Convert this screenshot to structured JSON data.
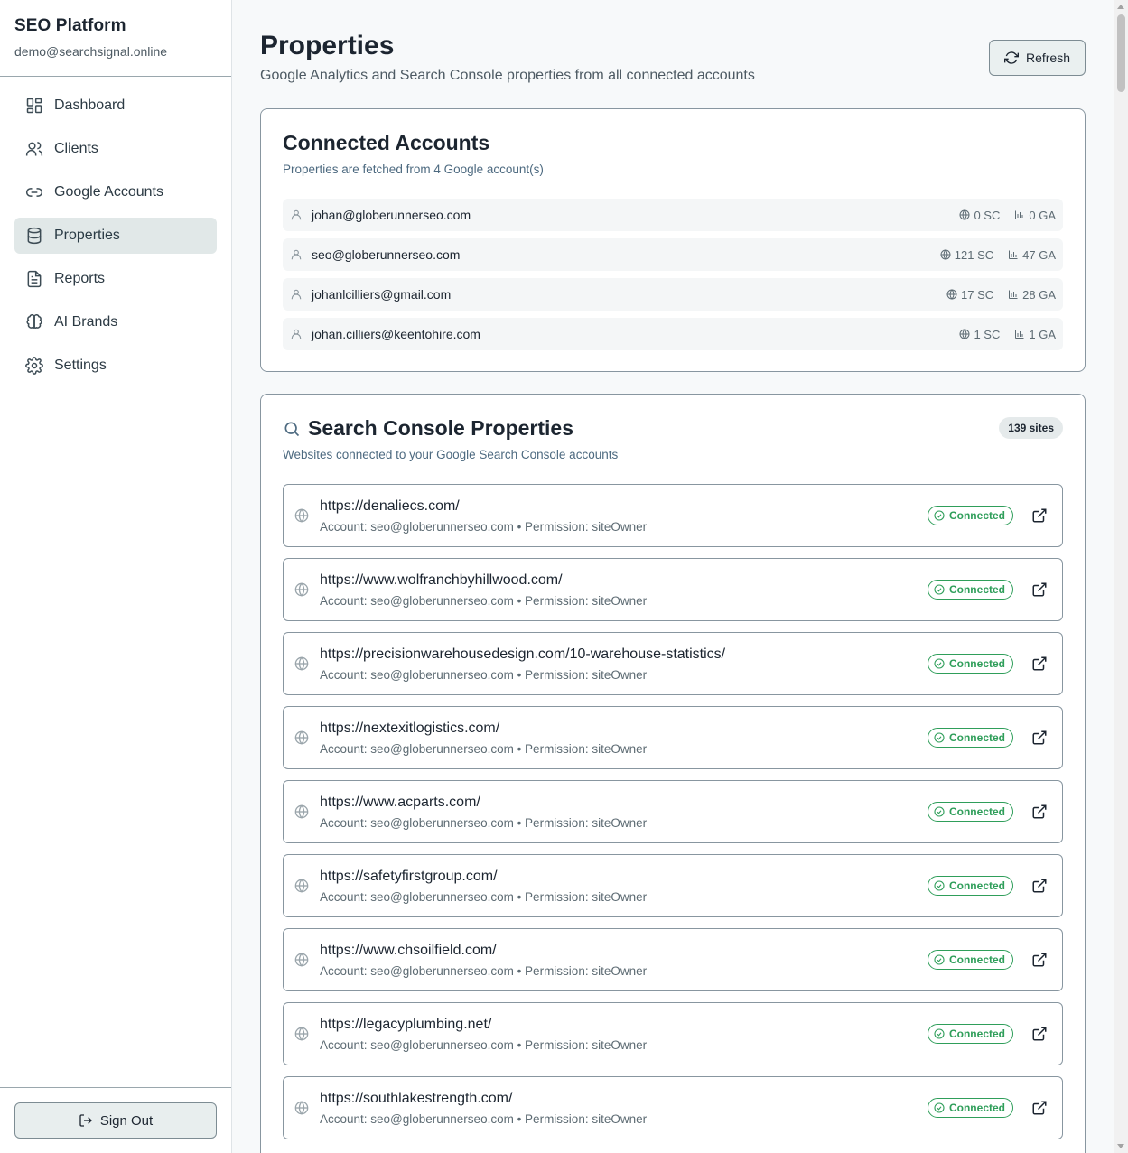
{
  "sidebar": {
    "brand_title": "SEO Platform",
    "brand_email": "demo@searchsignal.online",
    "items": [
      {
        "label": "Dashboard",
        "icon": "dashboard-icon"
      },
      {
        "label": "Clients",
        "icon": "users-icon"
      },
      {
        "label": "Google Accounts",
        "icon": "link-icon"
      },
      {
        "label": "Properties",
        "icon": "database-icon",
        "active": true
      },
      {
        "label": "Reports",
        "icon": "file-text-icon"
      },
      {
        "label": "AI Brands",
        "icon": "brain-icon"
      },
      {
        "label": "Settings",
        "icon": "gear-icon"
      }
    ],
    "signout_label": "Sign Out"
  },
  "header": {
    "title": "Properties",
    "subtitle": "Google Analytics and Search Console properties from all connected accounts",
    "refresh_label": "Refresh"
  },
  "accounts": {
    "title": "Connected Accounts",
    "subtitle": "Properties are fetched from 4 Google account(s)",
    "rows": [
      {
        "email": "johan@globerunnerseo.com",
        "sc": "0 SC",
        "ga": "0 GA"
      },
      {
        "email": "seo@globerunnerseo.com",
        "sc": "121 SC",
        "ga": "47 GA"
      },
      {
        "email": "johanlcilliers@gmail.com",
        "sc": "17 SC",
        "ga": "28 GA"
      },
      {
        "email": "johan.cilliers@keentohire.com",
        "sc": "1 SC",
        "ga": "1 GA"
      }
    ]
  },
  "search_console": {
    "title": "Search Console Properties",
    "subtitle": "Websites connected to your Google Search Console accounts",
    "count_badge": "139 sites",
    "status_label": "Connected",
    "properties": [
      {
        "url": "https://denaliecs.com/",
        "meta": "Account: seo@globerunnerseo.com • Permission: siteOwner"
      },
      {
        "url": "https://www.wolfranchbyhillwood.com/",
        "meta": "Account: seo@globerunnerseo.com • Permission: siteOwner"
      },
      {
        "url": "https://precisionwarehousedesign.com/10-warehouse-statistics/",
        "meta": "Account: seo@globerunnerseo.com • Permission: siteOwner"
      },
      {
        "url": "https://nextexitlogistics.com/",
        "meta": "Account: seo@globerunnerseo.com • Permission: siteOwner"
      },
      {
        "url": "https://www.acparts.com/",
        "meta": "Account: seo@globerunnerseo.com • Permission: siteOwner"
      },
      {
        "url": "https://safetyfirstgroup.com/",
        "meta": "Account: seo@globerunnerseo.com • Permission: siteOwner"
      },
      {
        "url": "https://www.chsoilfield.com/",
        "meta": "Account: seo@globerunnerseo.com • Permission: siteOwner"
      },
      {
        "url": "https://legacyplumbing.net/",
        "meta": "Account: seo@globerunnerseo.com • Permission: siteOwner"
      },
      {
        "url": "https://southlakestrength.com/",
        "meta": "Account: seo@globerunnerseo.com • Permission: siteOwner"
      }
    ]
  },
  "colors": {
    "accent_active_bg": "#e1e8e8",
    "connected_green": "#2f9e5a",
    "border": "#8896a0"
  }
}
